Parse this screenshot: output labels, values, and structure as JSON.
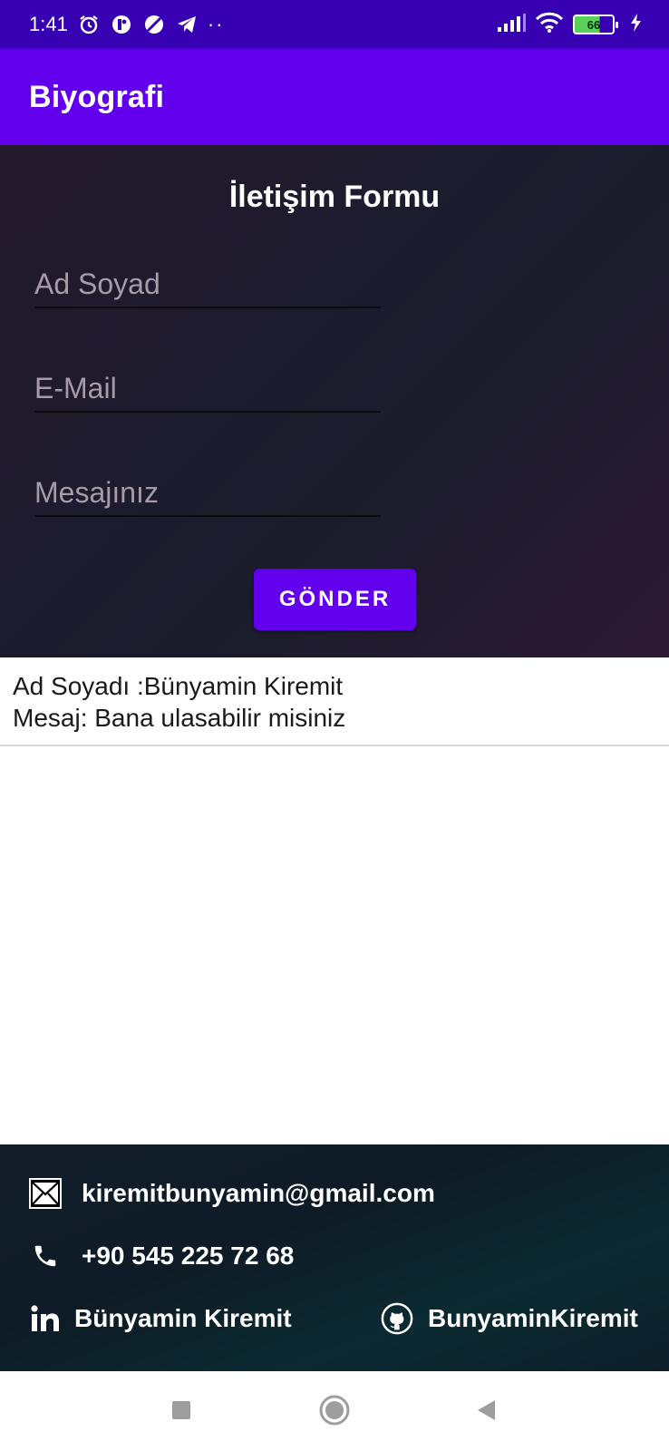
{
  "status_bar": {
    "time": "1:41",
    "dots": "··",
    "battery_level": "66",
    "icons": [
      "alarm-icon",
      "app-icon",
      "blocked-icon",
      "telegram-icon",
      "signal-icon",
      "wifi-icon",
      "battery-icon",
      "charging-icon"
    ]
  },
  "app_bar": {
    "title": "Biyografi"
  },
  "form": {
    "title": "İletişim Formu",
    "name_placeholder": "Ad Soyad",
    "email_placeholder": "E-Mail",
    "message_placeholder": "Mesajınız",
    "submit_label": "GÖNDER"
  },
  "messages": [
    {
      "name_line": "Ad Soyadı :Bünyamin Kiremit",
      "message_line": "Mesaj: Bana ulasabilir misiniz"
    }
  ],
  "footer": {
    "email": "kiremitbunyamin@gmail.com",
    "phone": "+90 545 225 72 68",
    "linkedin": "Bünyamin Kiremit",
    "github": "BunyaminKiremit"
  },
  "colors": {
    "status_bar": "#3700b3",
    "primary": "#6200ee",
    "form_bg": "#1d1b2e",
    "footer_bg": "#0e1b26"
  }
}
